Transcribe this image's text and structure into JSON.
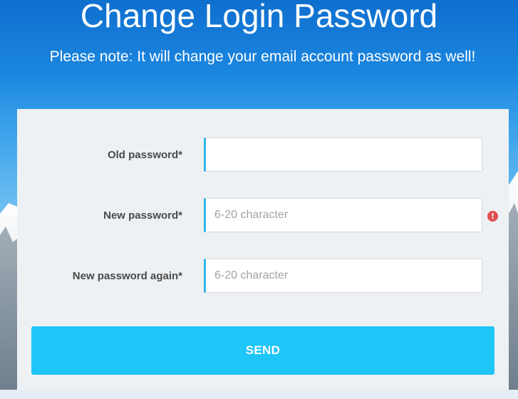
{
  "header": {
    "title": "Change Login Password",
    "note": "Please note: It will change your email account password as well!"
  },
  "form": {
    "old_password": {
      "label": "Old password*",
      "value": "",
      "placeholder": ""
    },
    "new_password": {
      "label": "New password*",
      "value": "",
      "placeholder": "6-20 character",
      "info_icon": "!"
    },
    "new_password_again": {
      "label": "New password again*",
      "value": "",
      "placeholder": "6-20 character"
    },
    "send_label": "SEND"
  },
  "colors": {
    "accent": "#1ec5f7",
    "field_border_accent": "#2fb6ea",
    "error": "#e04d4d",
    "panel": "#eef1f4"
  },
  "icons": {
    "info": "exclamation-circle-icon"
  }
}
